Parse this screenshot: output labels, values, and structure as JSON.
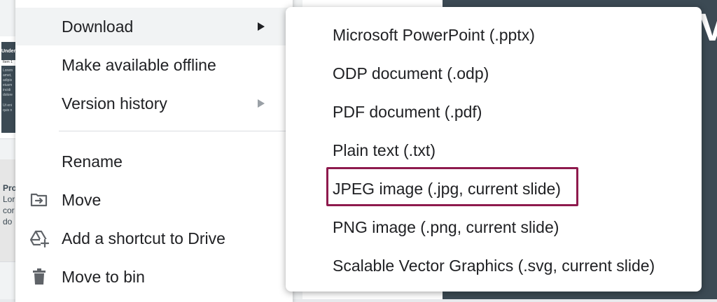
{
  "background": {
    "slide1_title": "Under",
    "slide1_bar_text": "Item 1",
    "slide1_lines": [
      "Lorem",
      "amet,",
      "adipis",
      "eiusm",
      "incidi",
      "dolore",
      "Ut eni",
      "quis n"
    ],
    "slide2_lines": [
      "Pro",
      "Lor",
      "cor",
      "do"
    ],
    "big_letter": "V"
  },
  "main_menu": {
    "items": [
      {
        "label": "Download",
        "has_submenu": true
      },
      {
        "label": "Make available offline"
      },
      {
        "label": "Version history",
        "has_submenu": true
      },
      {
        "label": "Rename"
      },
      {
        "label": "Move",
        "icon": "folder-move-icon"
      },
      {
        "label": "Add a shortcut to Drive",
        "icon": "drive-shortcut-icon"
      },
      {
        "label": "Move to bin",
        "icon": "trash-icon"
      }
    ]
  },
  "download_submenu": {
    "items": [
      {
        "label": "Microsoft PowerPoint (.pptx)"
      },
      {
        "label": "ODP document (.odp)"
      },
      {
        "label": "PDF document (.pdf)"
      },
      {
        "label": "Plain text (.txt)"
      },
      {
        "label": "JPEG image (.jpg, current slide)",
        "highlighted": true
      },
      {
        "label": "PNG image (.png, current slide)"
      },
      {
        "label": "Scalable Vector Graphics (.svg, current slide)"
      }
    ],
    "highlight_color": "#8e1a4d"
  }
}
